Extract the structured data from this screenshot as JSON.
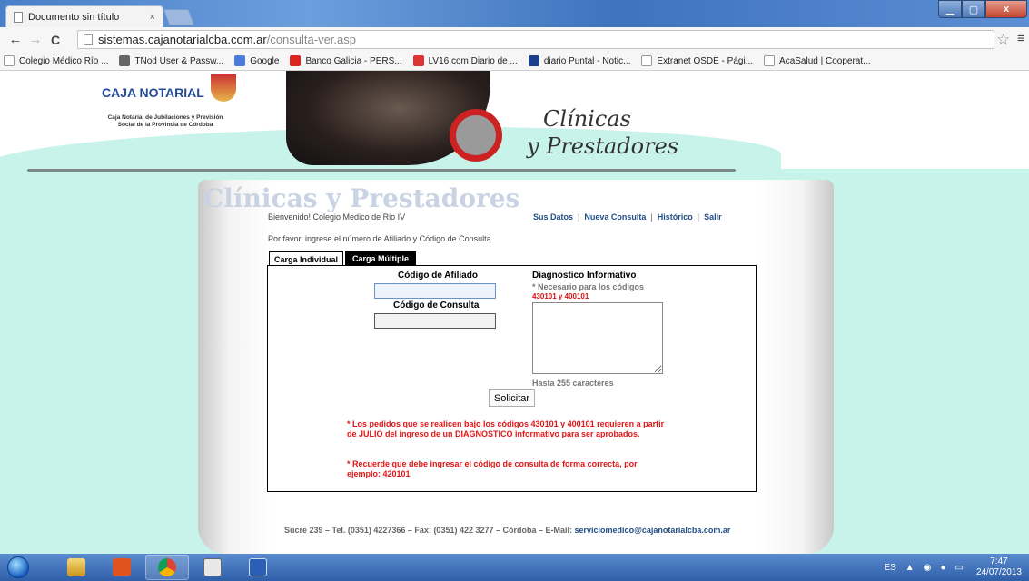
{
  "browser": {
    "tab_title": "Documento sin título",
    "tab_close": "×",
    "url_host": "sistemas.cajanotarialcba.com.ar",
    "url_path": "/consulta-ver.asp",
    "back": "←",
    "forward": "→",
    "reload": "C",
    "star": "☆",
    "menu": "≡",
    "min": "▁",
    "max": "▢",
    "close": "x"
  },
  "bookmarks": [
    {
      "label": "Colegio Médico Río ...",
      "icon": "page-icon",
      "color": "#ffffff"
    },
    {
      "label": "TNod User & Passw...",
      "icon": "gear-icon",
      "color": "#666666"
    },
    {
      "label": "Google",
      "icon": "google-icon",
      "color": "#4a7bd8"
    },
    {
      "label": "Banco Galicia - PERS...",
      "icon": "galicia-icon",
      "color": "#d22"
    },
    {
      "label": "LV16.com Diario de ...",
      "icon": "lv16-icon",
      "color": "#d33"
    },
    {
      "label": "diario Puntal - Notic...",
      "icon": "puntal-icon",
      "color": "#1d3e8a"
    },
    {
      "label": "Extranet OSDE - Pági...",
      "icon": "page-icon",
      "color": "#ffffff"
    },
    {
      "label": "AcaSalud | Cooperat...",
      "icon": "page-icon",
      "color": "#ffffff"
    }
  ],
  "header": {
    "logo_name": "CAJA NOTARIAL",
    "logo_sub": "Caja Notarial de Jubilaciones y Previsión Social de la Provincia de Córdoba",
    "title_line1": "Clínicas",
    "title_line2": "y Prestadores"
  },
  "page": {
    "watermark": "Clínicas y Prestadores",
    "welcome": "Bienvenido! Colegio Medico de Rio IV",
    "nav": [
      "Sus Datos",
      "Nueva Consulta",
      "Histórico",
      "Salir"
    ],
    "nav_sep": "|",
    "prompt": "Por favor, ingrese el número de Afiliado y Código de Consulta",
    "tabs": [
      "Carga Individual",
      "Carga Múltiple"
    ]
  },
  "form": {
    "afiliado_label": "Código de Afiliado",
    "afiliado_value": "",
    "consulta_label": "Código de Consulta",
    "consulta_value": "",
    "diag_label": "Diagnostico Informativo",
    "diag_note": "* Necesario para los códigos",
    "diag_codes": "430101 y 400101",
    "diag_limit": "Hasta 255 caracteres",
    "submit": "Solicitar",
    "warning1": "* Los pedidos que se realicen bajo los códigos 430101 y 400101 requieren a partir de JULIO del ingreso de un DIAGNOSTICO informativo para ser aprobados.",
    "warning2": "* Recuerde que debe ingresar el código de consulta de forma correcta, por ejemplo: 420101"
  },
  "footer": {
    "address": "Sucre 239 – Tel. (0351) 4227366 – Fax: (0351) 422 3277 – Córdoba – E-Mail:",
    "email": "serviciomedico@cajanotarialcba.com.ar"
  },
  "taskbar": {
    "lang": "ES",
    "time": "7:47",
    "date": "24/07/2013"
  }
}
